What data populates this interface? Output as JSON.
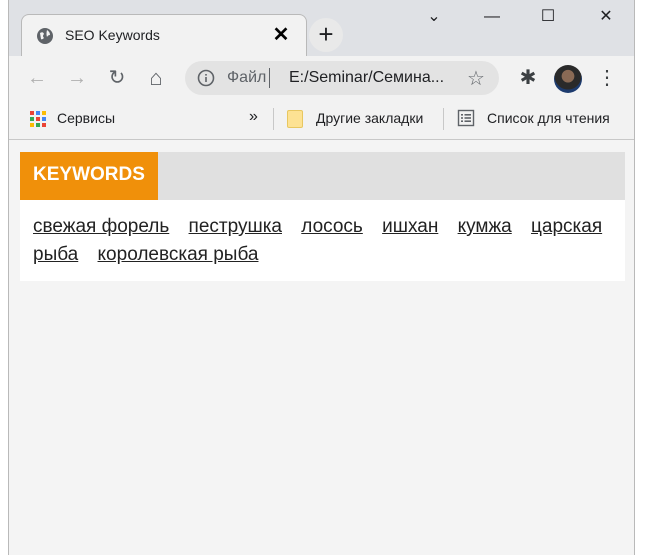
{
  "tab": {
    "title": "SEO Keywords",
    "close_glyph": "✕",
    "new_tab_glyph": "+"
  },
  "window_controls": {
    "dropdown_glyph": "⌄",
    "minimize_glyph": "—",
    "maximize_glyph": "☐",
    "close_glyph": "✕"
  },
  "toolbar": {
    "back_glyph": "←",
    "forward_glyph": "→",
    "reload_glyph": "↻",
    "home_glyph": "⌂",
    "omnibox": {
      "scheme_label": "Файл",
      "url": "E:/Seminar/Семина...",
      "star_glyph": "☆"
    },
    "extensions_glyph": "✱",
    "menu_glyph": "⋮"
  },
  "bookmarks": {
    "apps_label": "Сервисы",
    "overflow_glyph": "»",
    "other_bookmarks_label": "Другие закладки",
    "reading_list_label": "Список для чтения"
  },
  "page": {
    "keywords_title": "KEYWORDS",
    "keywords": [
      "свежая форель",
      "пеструшка",
      "лосось",
      "ишхан",
      "кумжа",
      "царская рыба",
      "королевская рыба"
    ]
  },
  "colors": {
    "accent_orange": "#f0900a",
    "header_gray": "#e0e0e0"
  }
}
